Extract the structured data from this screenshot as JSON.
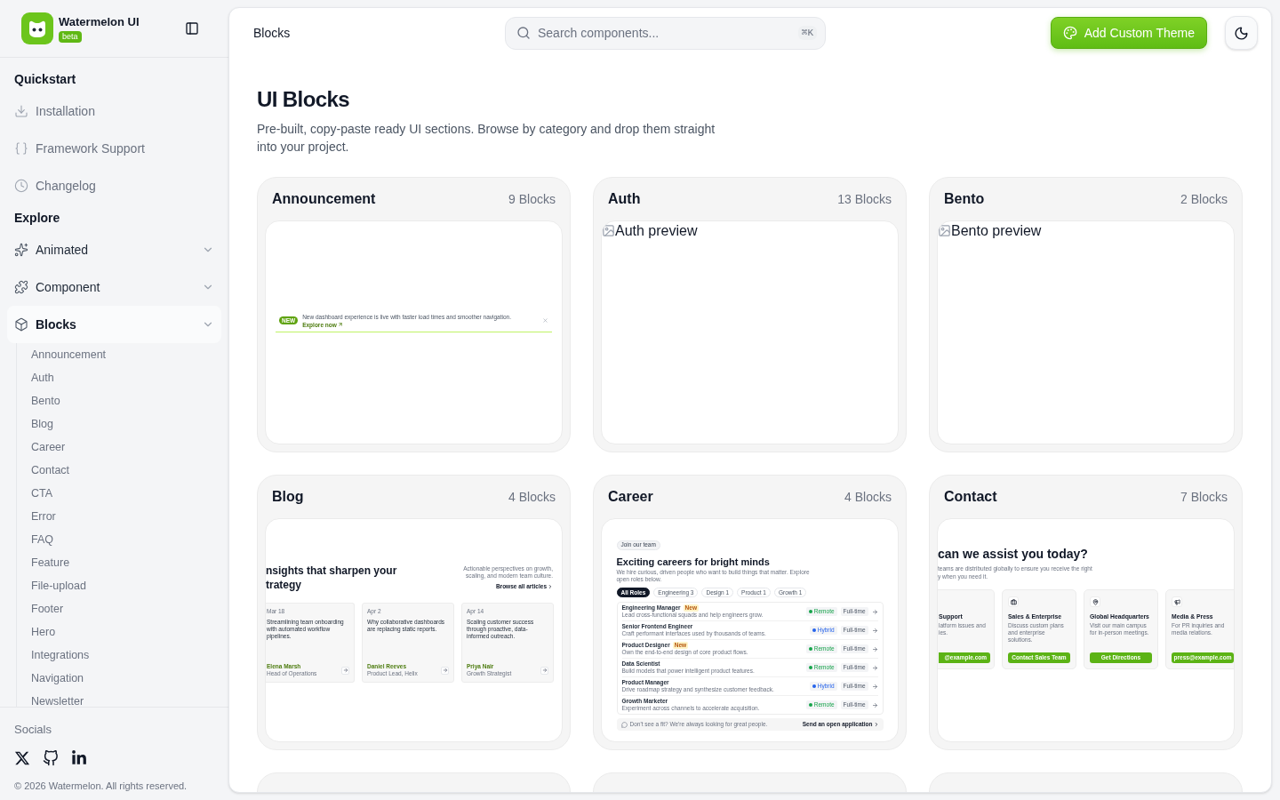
{
  "sidebar": {
    "brand": {
      "name": "Watermelon UI",
      "badge": "beta"
    },
    "sections": [
      {
        "kind": "links",
        "heading": "Quickstart",
        "items": [
          {
            "label": "Installation"
          },
          {
            "label": "Framework Support"
          },
          {
            "label": "Changelog"
          }
        ]
      },
      {
        "kind": "groups",
        "heading": "Explore",
        "items": [
          {
            "label": "Animated",
            "expanded": false
          },
          {
            "label": "Component",
            "expanded": false
          },
          {
            "label": "Blocks",
            "expanded": true,
            "children": [
              "Announcement",
              "Auth",
              "Bento",
              "Blog",
              "Career",
              "Contact",
              "CTA",
              "Error",
              "FAQ",
              "Feature",
              "File-upload",
              "Footer",
              "Hero",
              "Integrations",
              "Navigation",
              "Newsletter"
            ]
          }
        ]
      }
    ],
    "socials_heading": "Socials",
    "copyright": "© 2026 Watermelon. All rights reserved."
  },
  "header": {
    "title": "Blocks",
    "search": {
      "placeholder": "Search components...",
      "shortcut": "⌘K"
    },
    "add_theme_button": "Add Custom Theme"
  },
  "page": {
    "title": "UI Blocks",
    "description": "Pre-built, copy-paste ready UI sections. Browse by category and drop them straight into your project."
  },
  "categories": [
    {
      "kind": "full",
      "title": "Announcement",
      "count": "9 Blocks",
      "preview": {
        "kind": "announcement",
        "badge": "NEW",
        "message": "New dashboard experience is live with faster load times and smoother navigation.",
        "link": "Explore now"
      }
    },
    {
      "kind": "full",
      "title": "Auth",
      "count": "13 Blocks",
      "preview": {
        "kind": "image",
        "alt": "Auth preview"
      }
    },
    {
      "kind": "full",
      "title": "Bento",
      "count": "2 Blocks",
      "preview": {
        "kind": "image",
        "alt": "Bento preview"
      }
    },
    {
      "kind": "full",
      "title": "Blog",
      "count": "4 Blocks",
      "preview": {
        "kind": "blog",
        "heading_lines": [
          "nsights that sharpen your",
          "trategy"
        ],
        "intro": "Actionable perspectives on growth, scaling, and modern team culture.",
        "link": "Browse all articles",
        "posts": [
          {
            "date": "Mar 18",
            "title": "Streamlining team onboarding with automated workflow pipelines.",
            "author": "Elena Marsh",
            "role": "Head of Operations"
          },
          {
            "date": "Apr 2",
            "title": "Why collaborative dashboards are replacing static reports.",
            "author": "Daniel Reeves",
            "role": "Product Lead, Helix"
          },
          {
            "date": "Apr 14",
            "title": "Scaling customer success through proactive, data-informed outreach.",
            "author": "Priya Nair",
            "role": "Growth Strategist"
          }
        ]
      }
    },
    {
      "kind": "full",
      "title": "Career",
      "count": "4 Blocks",
      "preview": {
        "kind": "careers",
        "eyebrow": "Join our team",
        "title": "Exciting careers for bright minds",
        "subtitle": "We hire curious, driven people who want to build things that matter. Explore open roles below.",
        "filters": [
          {
            "label": "All Roles",
            "selected": true
          },
          {
            "label": "Engineering 3",
            "selected": false
          },
          {
            "label": "Design 1",
            "selected": false
          },
          {
            "label": "Product 1",
            "selected": false
          },
          {
            "label": "Growth 1",
            "selected": false
          }
        ],
        "jobs": [
          {
            "title": "Engineering Manager",
            "badge": "New",
            "summary": "Lead cross-functional squads and help engineers grow.",
            "location": {
              "label": "Remote",
              "color": "#16a34a"
            },
            "type": "Full-time"
          },
          {
            "title": "Senior Frontend Engineer",
            "summary": "Craft performant interfaces used by thousands of teams.",
            "location": {
              "label": "Hybrid",
              "color": "#2563eb"
            },
            "type": "Full-time"
          },
          {
            "title": "Product Designer",
            "badge": "New",
            "summary": "Own the end-to-end design of core product flows.",
            "location": {
              "label": "Remote",
              "color": "#16a34a"
            },
            "type": "Full-time"
          },
          {
            "title": "Data Scientist",
            "summary": "Build models that power intelligent product features.",
            "location": {
              "label": "Remote",
              "color": "#16a34a"
            },
            "type": "Full-time"
          },
          {
            "title": "Product Manager",
            "summary": "Drive roadmap strategy and synthesize customer feedback.",
            "location": {
              "label": "Hybrid",
              "color": "#2563eb"
            },
            "type": "Full-time"
          },
          {
            "title": "Growth Marketer",
            "summary": "Experiment across channels to accelerate acquisition.",
            "location": {
              "label": "Remote",
              "color": "#16a34a"
            },
            "type": "Full-time"
          }
        ],
        "footer": "Don't see a fit? We're always looking for great people.",
        "footer_link": "Send an open application"
      }
    },
    {
      "kind": "full",
      "title": "Contact",
      "count": "7 Blocks",
      "preview": {
        "kind": "contact",
        "heading": "can we assist you today?",
        "subtitle_lines": [
          "teams are distributed globally to ensure you receive the right",
          "y when you need it."
        ],
        "channels": [
          {
            "kind": "clipped",
            "title": "Support",
            "lines": [
              "latform issues and",
              "ies."
            ],
            "action": "@example.com"
          },
          {
            "kind": "card",
            "title": "Sales & Enterprise",
            "description": "Discuss custom plans and enterprise solutions.",
            "action": "Contact Sales Team"
          },
          {
            "kind": "card",
            "title": "Global Headquarters",
            "description": "Visit our main campus for in-person meetings.",
            "action": "Get Directions"
          },
          {
            "kind": "card",
            "title": "Media & Press",
            "description": "For PR inquiries and media relations.",
            "action": "press@example.com"
          }
        ]
      }
    },
    {
      "kind": "clipped"
    },
    {
      "kind": "clipped"
    },
    {
      "kind": "clipped"
    }
  ]
}
